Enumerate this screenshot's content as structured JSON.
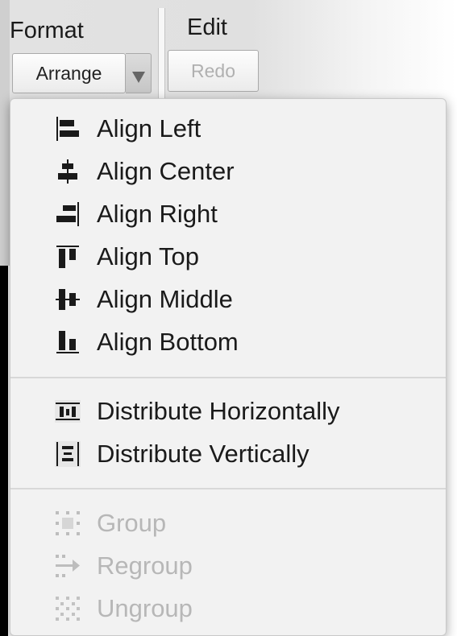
{
  "toolbar": {
    "format_label": "Format",
    "edit_label": "Edit",
    "arrange_button": "Arrange",
    "redo_button": "Redo"
  },
  "menu": {
    "align_items": [
      {
        "label": "Align Left",
        "icon": "align-left-icon"
      },
      {
        "label": "Align Center",
        "icon": "align-center-icon"
      },
      {
        "label": "Align Right",
        "icon": "align-right-icon"
      },
      {
        "label": "Align Top",
        "icon": "align-top-icon"
      },
      {
        "label": "Align Middle",
        "icon": "align-middle-icon"
      },
      {
        "label": "Align Bottom",
        "icon": "align-bottom-icon"
      }
    ],
    "distribute_items": [
      {
        "label": "Distribute Horizontally",
        "icon": "distribute-horizontal-icon"
      },
      {
        "label": "Distribute Vertically",
        "icon": "distribute-vertical-icon"
      }
    ],
    "group_items": [
      {
        "label": "Group",
        "icon": "group-icon",
        "enabled": false
      },
      {
        "label": "Regroup",
        "icon": "regroup-icon",
        "enabled": false
      },
      {
        "label": "Ungroup",
        "icon": "ungroup-icon",
        "enabled": false
      }
    ]
  },
  "colors": {
    "menu_background": "#f2f2f2",
    "disabled_text": "#b7b7b7",
    "icon_dark": "#1a1a1a"
  }
}
